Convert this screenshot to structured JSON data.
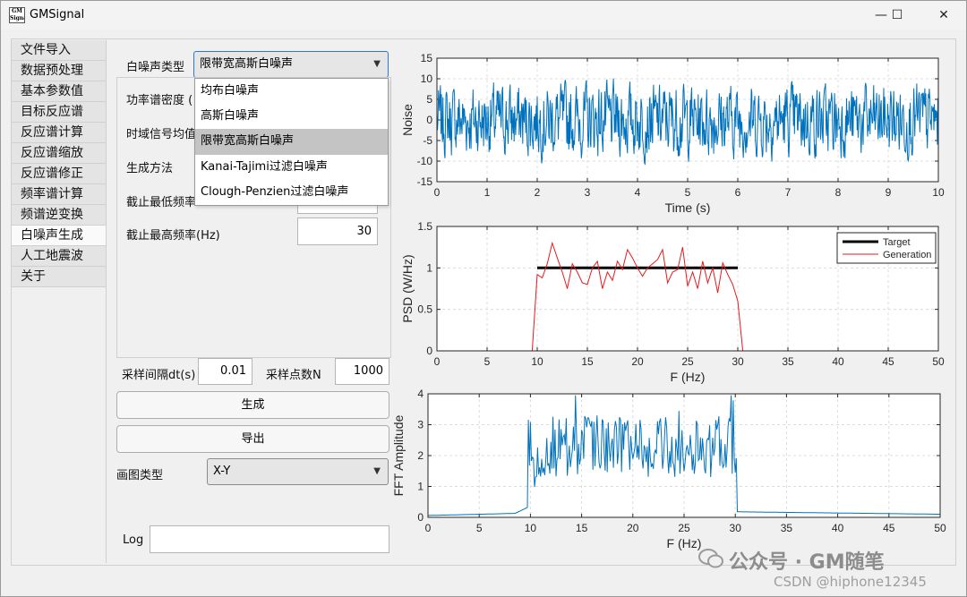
{
  "window": {
    "title": "GMSignal",
    "icon_text": "GM Signal",
    "minimize": "—",
    "maximize": "☐",
    "close": "✕"
  },
  "nav": [
    {
      "label": "文件导入"
    },
    {
      "label": "数据预处理"
    },
    {
      "label": "基本参数值"
    },
    {
      "label": "目标反应谱"
    },
    {
      "label": "反应谱计算"
    },
    {
      "label": "反应谱缩放"
    },
    {
      "label": "反应谱修正"
    },
    {
      "label": "频率谱计算"
    },
    {
      "label": "频谱逆变换"
    },
    {
      "label": "白噪声生成",
      "active": true
    },
    {
      "label": "人工地震波"
    },
    {
      "label": "关于"
    }
  ],
  "form": {
    "noise_type_label": "白噪声类型",
    "noise_type_value": "限带宽高斯白噪声",
    "noise_type_options": [
      "均布白噪声",
      "高斯白噪声",
      "限带宽高斯白噪声",
      "Kanai-Tajimi过滤白噪声",
      "Clough-Penzien过滤白噪声"
    ],
    "psd_label": "功率谱密度 (",
    "mean_label": "时域信号均值",
    "method_label": "生成方法",
    "fmin_label": "截止最低频率",
    "fmax_label": "截止最高频率(Hz)",
    "fmax_value": "30",
    "dt_label": "采样间隔dt(s)",
    "dt_value": "0.01",
    "n_label": "采样点数N",
    "n_value": "1000",
    "generate_label": "生成",
    "export_label": "导出",
    "plot_type_label": "画图类型",
    "plot_type_value": "X-Y",
    "log_label": "Log",
    "log_value": ""
  },
  "icons": {
    "dropdown_arrow": "▼"
  },
  "watermark": {
    "logo": "wechat-logo",
    "main": "公众号 · GM随笔",
    "sub": "CSDN @hiphone12345"
  },
  "chart_data": [
    {
      "type": "line",
      "xlabel": "Time (s)",
      "ylabel": "Noise",
      "xlim": [
        0,
        10
      ],
      "ylim": [
        -15,
        15
      ],
      "xticks": [
        0,
        1,
        2,
        3,
        4,
        5,
        6,
        7,
        8,
        9,
        10
      ],
      "yticks": [
        -15,
        -10,
        -5,
        0,
        5,
        10,
        15
      ],
      "grid": true,
      "color": "#0072bd",
      "series": [
        {
          "sampling": "dt 0.01 s, 1000 points, band-limited gaussian noise, range about -12 to 12"
        }
      ]
    },
    {
      "type": "line",
      "xlabel": "F (Hz)",
      "ylabel": "PSD (W/Hz)",
      "xlim": [
        0,
        50
      ],
      "ylim": [
        0,
        1.5
      ],
      "xticks": [
        0,
        5,
        10,
        15,
        20,
        25,
        30,
        35,
        40,
        45,
        50
      ],
      "yticks": [
        0,
        0.5,
        1,
        1.5
      ],
      "grid": true,
      "legend": "top-right",
      "series": [
        {
          "name": "Target",
          "color": "#000000",
          "x": [
            10,
            30
          ],
          "y": [
            1,
            1
          ]
        },
        {
          "name": "Generation",
          "color": "#e41a1c",
          "x": [
            0,
            9.5,
            10,
            10.5,
            11,
            11.5,
            12,
            12.5,
            13,
            13.5,
            14,
            14.5,
            15,
            15.5,
            16,
            16.5,
            17,
            17.5,
            18,
            18.5,
            19,
            19.5,
            20,
            20.5,
            21,
            21.5,
            22,
            22.5,
            23,
            23.5,
            24,
            24.5,
            25,
            25.5,
            26,
            26.5,
            27,
            27.5,
            28,
            28.5,
            29,
            29.5,
            30,
            30.5,
            50
          ],
          "y": [
            0,
            0,
            0.92,
            0.88,
            1.05,
            1.3,
            1.12,
            0.95,
            0.75,
            1.05,
            0.95,
            0.82,
            0.8,
            1.0,
            1.08,
            0.75,
            0.95,
            0.85,
            1.08,
            0.98,
            1.22,
            1.12,
            1.0,
            0.9,
            1.0,
            1.05,
            1.1,
            1.22,
            0.82,
            0.95,
            0.98,
            1.25,
            0.78,
            0.95,
            0.75,
            1.08,
            0.82,
            1.0,
            0.7,
            1.06,
            0.92,
            0.8,
            0.6,
            0,
            0
          ]
        }
      ]
    },
    {
      "type": "line",
      "xlabel": "F (Hz)",
      "ylabel": "FFT Amplitude",
      "xlim": [
        0,
        50
      ],
      "ylim": [
        0,
        4
      ],
      "xticks": [
        0,
        5,
        10,
        15,
        20,
        25,
        30,
        35,
        40,
        45,
        50
      ],
      "yticks": [
        0,
        1,
        2,
        3,
        4
      ],
      "grid": true,
      "color": "#0072bd",
      "series": [
        {
          "description": "near 0.1 below 10 Hz, 1-4 between 10 and 30 Hz, near 0.1 above 30 Hz"
        }
      ]
    }
  ]
}
